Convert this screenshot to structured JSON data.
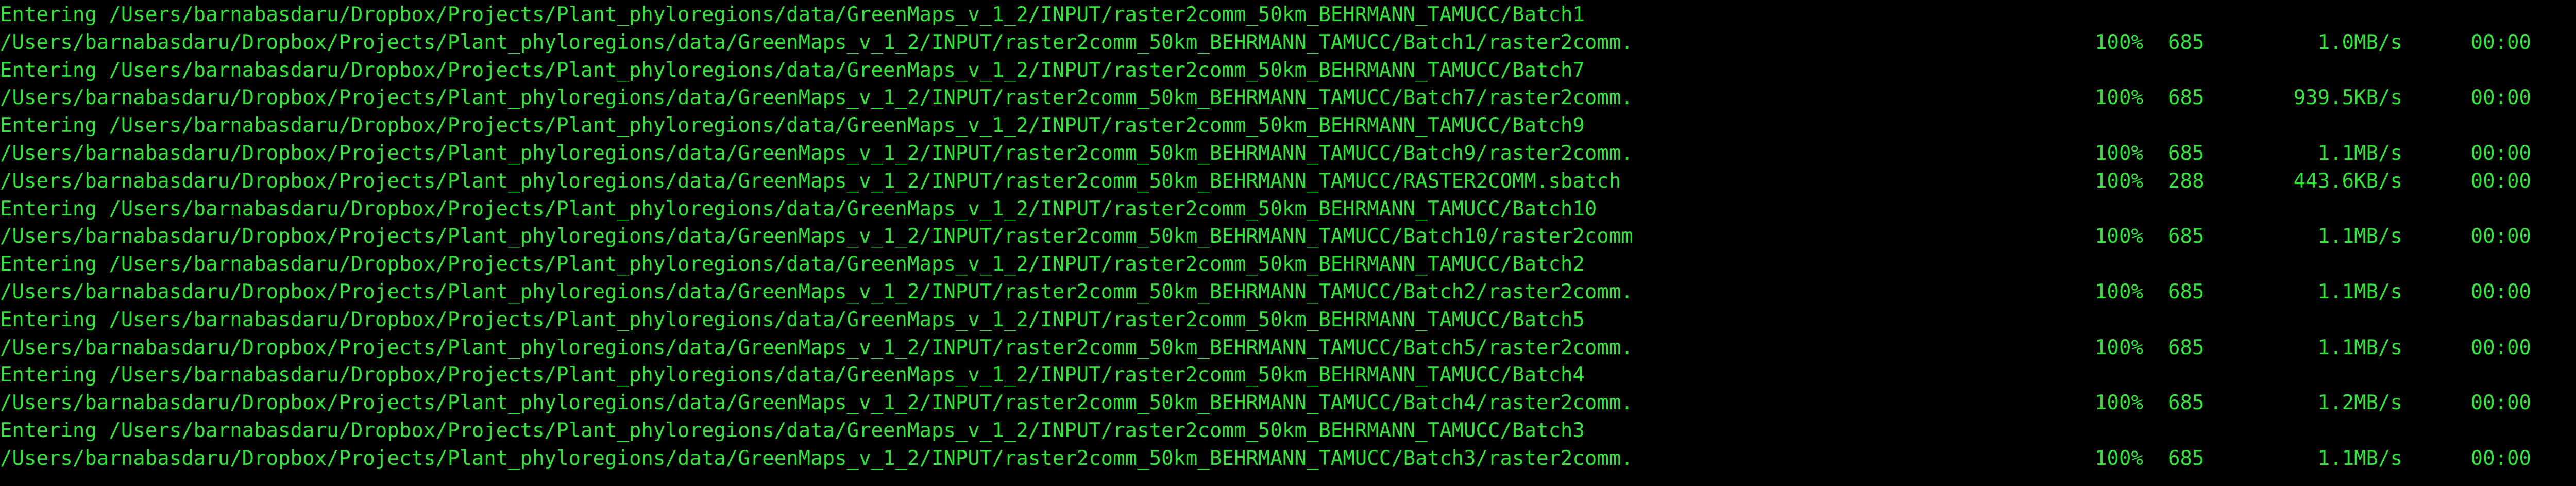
{
  "terminal": {
    "text_color": "#31E53A",
    "background": "#000000",
    "lines": [
      {
        "kind": "enter",
        "text": "Entering /Users/barnabasdaru/Dropbox/Projects/Plant_phyloregions/data/GreenMaps_v_1_2/INPUT/raster2comm_50km_BEHRMANN_TAMUCC/Batch1"
      },
      {
        "kind": "transfer",
        "path": "/Users/barnabasdaru/Dropbox/Projects/Plant_phyloregions/data/GreenMaps_v_1_2/INPUT/raster2comm_50km_BEHRMANN_TAMUCC/Batch1/raster2comm.",
        "percent": "100%",
        "size": "685",
        "rate": "1.0MB/s",
        "eta": "00:00"
      },
      {
        "kind": "enter",
        "text": "Entering /Users/barnabasdaru/Dropbox/Projects/Plant_phyloregions/data/GreenMaps_v_1_2/INPUT/raster2comm_50km_BEHRMANN_TAMUCC/Batch7"
      },
      {
        "kind": "transfer",
        "path": "/Users/barnabasdaru/Dropbox/Projects/Plant_phyloregions/data/GreenMaps_v_1_2/INPUT/raster2comm_50km_BEHRMANN_TAMUCC/Batch7/raster2comm.",
        "percent": "100%",
        "size": "685",
        "rate": "939.5KB/s",
        "eta": "00:00"
      },
      {
        "kind": "enter",
        "text": "Entering /Users/barnabasdaru/Dropbox/Projects/Plant_phyloregions/data/GreenMaps_v_1_2/INPUT/raster2comm_50km_BEHRMANN_TAMUCC/Batch9"
      },
      {
        "kind": "transfer",
        "path": "/Users/barnabasdaru/Dropbox/Projects/Plant_phyloregions/data/GreenMaps_v_1_2/INPUT/raster2comm_50km_BEHRMANN_TAMUCC/Batch9/raster2comm.",
        "percent": "100%",
        "size": "685",
        "rate": "1.1MB/s",
        "eta": "00:00"
      },
      {
        "kind": "transfer",
        "path": "/Users/barnabasdaru/Dropbox/Projects/Plant_phyloregions/data/GreenMaps_v_1_2/INPUT/raster2comm_50km_BEHRMANN_TAMUCC/RASTER2COMM.sbatch",
        "percent": "100%",
        "size": "288",
        "rate": "443.6KB/s",
        "eta": "00:00"
      },
      {
        "kind": "enter",
        "text": "Entering /Users/barnabasdaru/Dropbox/Projects/Plant_phyloregions/data/GreenMaps_v_1_2/INPUT/raster2comm_50km_BEHRMANN_TAMUCC/Batch10"
      },
      {
        "kind": "transfer",
        "path": "/Users/barnabasdaru/Dropbox/Projects/Plant_phyloregions/data/GreenMaps_v_1_2/INPUT/raster2comm_50km_BEHRMANN_TAMUCC/Batch10/raster2comm",
        "percent": "100%",
        "size": "685",
        "rate": "1.1MB/s",
        "eta": "00:00"
      },
      {
        "kind": "enter",
        "text": "Entering /Users/barnabasdaru/Dropbox/Projects/Plant_phyloregions/data/GreenMaps_v_1_2/INPUT/raster2comm_50km_BEHRMANN_TAMUCC/Batch2"
      },
      {
        "kind": "transfer",
        "path": "/Users/barnabasdaru/Dropbox/Projects/Plant_phyloregions/data/GreenMaps_v_1_2/INPUT/raster2comm_50km_BEHRMANN_TAMUCC/Batch2/raster2comm.",
        "percent": "100%",
        "size": "685",
        "rate": "1.1MB/s",
        "eta": "00:00"
      },
      {
        "kind": "enter",
        "text": "Entering /Users/barnabasdaru/Dropbox/Projects/Plant_phyloregions/data/GreenMaps_v_1_2/INPUT/raster2comm_50km_BEHRMANN_TAMUCC/Batch5"
      },
      {
        "kind": "transfer",
        "path": "/Users/barnabasdaru/Dropbox/Projects/Plant_phyloregions/data/GreenMaps_v_1_2/INPUT/raster2comm_50km_BEHRMANN_TAMUCC/Batch5/raster2comm.",
        "percent": "100%",
        "size": "685",
        "rate": "1.1MB/s",
        "eta": "00:00"
      },
      {
        "kind": "enter",
        "text": "Entering /Users/barnabasdaru/Dropbox/Projects/Plant_phyloregions/data/GreenMaps_v_1_2/INPUT/raster2comm_50km_BEHRMANN_TAMUCC/Batch4"
      },
      {
        "kind": "transfer",
        "path": "/Users/barnabasdaru/Dropbox/Projects/Plant_phyloregions/data/GreenMaps_v_1_2/INPUT/raster2comm_50km_BEHRMANN_TAMUCC/Batch4/raster2comm.",
        "percent": "100%",
        "size": "685",
        "rate": "1.2MB/s",
        "eta": "00:00"
      },
      {
        "kind": "enter",
        "text": "Entering /Users/barnabasdaru/Dropbox/Projects/Plant_phyloregions/data/GreenMaps_v_1_2/INPUT/raster2comm_50km_BEHRMANN_TAMUCC/Batch3"
      },
      {
        "kind": "transfer",
        "path": "/Users/barnabasdaru/Dropbox/Projects/Plant_phyloregions/data/GreenMaps_v_1_2/INPUT/raster2comm_50km_BEHRMANN_TAMUCC/Batch3/raster2comm.",
        "percent": "100%",
        "size": "685",
        "rate": "1.1MB/s",
        "eta": "00:00"
      }
    ]
  }
}
